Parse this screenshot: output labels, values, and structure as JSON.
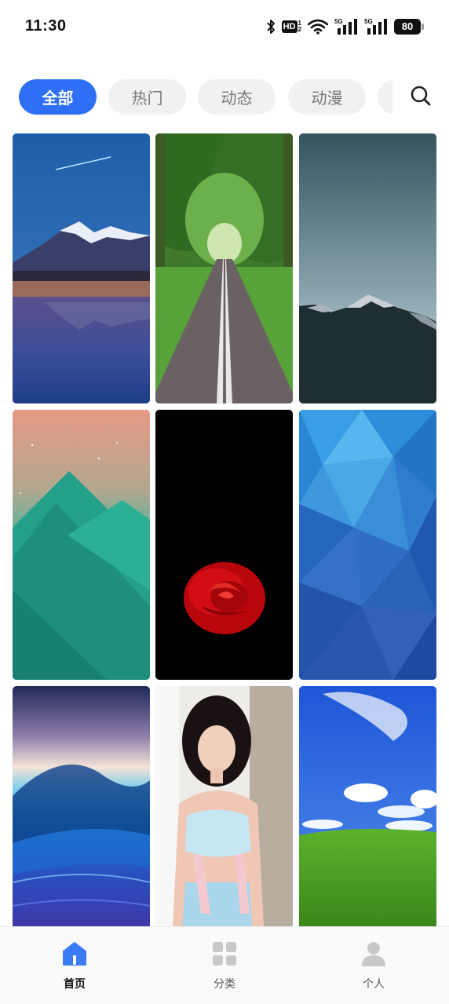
{
  "status_bar": {
    "time": "11:30",
    "hd_label": "HD",
    "hd_sub_top": "1",
    "hd_sub_bottom": "2",
    "signal_1_label": "5G",
    "signal_2_label": "5G",
    "battery_level": "80",
    "icons": [
      "bluetooth-icon",
      "hd-icon",
      "wifi-icon",
      "signal-5g-icon",
      "signal-5g-icon",
      "battery-icon"
    ]
  },
  "tabs": [
    {
      "label": "全部",
      "active": true
    },
    {
      "label": "热门",
      "active": false
    },
    {
      "label": "动态",
      "active": false
    },
    {
      "label": "动漫",
      "active": false
    }
  ],
  "search": {
    "icon": "search-icon"
  },
  "wallpapers": [
    {
      "name": "mountain-lake-reflection"
    },
    {
      "name": "tree-lined-road"
    },
    {
      "name": "mountain-peaks-dusk"
    },
    {
      "name": "teal-geometric-mountains"
    },
    {
      "name": "red-rose-black"
    },
    {
      "name": "blue-low-poly"
    },
    {
      "name": "blue-abstract-wave"
    },
    {
      "name": "portrait-photo"
    },
    {
      "name": "green-hill-blue-sky"
    }
  ],
  "bottom_nav": [
    {
      "label": "首页",
      "icon": "home-icon",
      "active": true
    },
    {
      "label": "分类",
      "icon": "category-icon",
      "active": false
    },
    {
      "label": "个人",
      "icon": "profile-icon",
      "active": false
    }
  ],
  "colors": {
    "accent": "#2f6ff5",
    "tab_inactive_bg": "#f0f1f3",
    "tab_inactive_text": "#777777"
  }
}
